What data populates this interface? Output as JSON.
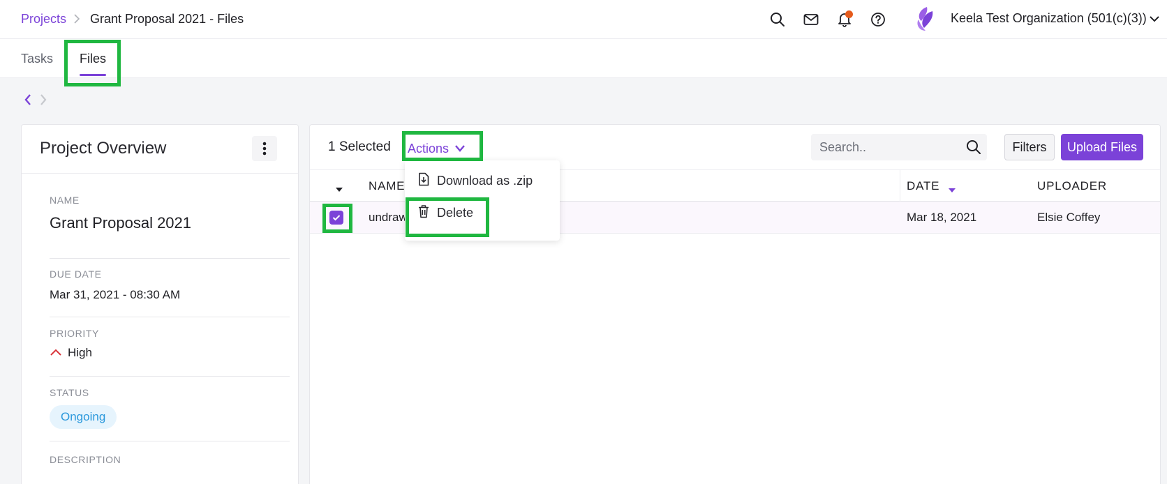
{
  "breadcrumb": {
    "root": "Projects",
    "current": "Grant Proposal 2021 - Files"
  },
  "header": {
    "icons": [
      "search-icon",
      "mail-icon",
      "bell-icon",
      "help-icon"
    ],
    "org_name": "Keela Test Organization (501(c)(3))"
  },
  "tabs": [
    {
      "label": "Tasks",
      "active": false
    },
    {
      "label": "Files",
      "active": true
    }
  ],
  "overview": {
    "title": "Project Overview",
    "name_label": "NAME",
    "name_value": "Grant Proposal 2021",
    "due_label": "DUE DATE",
    "due_value": "Mar 31, 2021 - 08:30 AM",
    "priority_label": "PRIORITY",
    "priority_value": "High",
    "status_label": "STATUS",
    "status_value": "Ongoing",
    "description_label": "DESCRIPTION"
  },
  "toolbar": {
    "selected_text": "1 Selected",
    "actions_label": "Actions",
    "search_placeholder": "Search..",
    "filters_label": "Filters",
    "upload_label": "Upload Files"
  },
  "table": {
    "columns": [
      "NAME",
      "DATE",
      "UPLOADER"
    ],
    "rows": [
      {
        "name": "undraw",
        "date": "Mar 18, 2021",
        "uploader": "Elsie Coffey",
        "checked": true
      }
    ]
  },
  "actions_menu": {
    "items": [
      {
        "label": "Download as .zip",
        "icon": "file-download-icon"
      },
      {
        "label": "Delete",
        "icon": "trash-icon"
      }
    ]
  },
  "colors": {
    "accent": "#7b42d8",
    "highlight": "#1fb740",
    "priority_high": "#d9343a",
    "status": "#2a98dc",
    "notification": "#e55b1c"
  }
}
